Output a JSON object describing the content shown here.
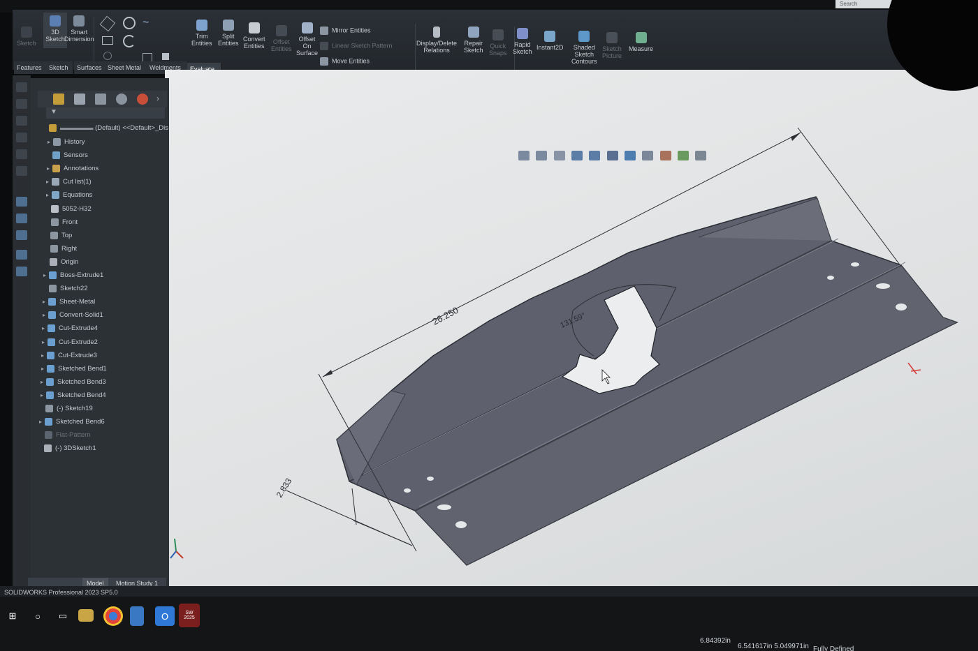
{
  "window": {
    "search_placeholder": "Search"
  },
  "ribbon": {
    "buttons": [
      {
        "label": "Sketch",
        "dim": true
      },
      {
        "label": "3D\nSketch"
      },
      {
        "label": "Smart\nDimension"
      },
      {
        "label": "Trim\nEntities"
      },
      {
        "label": "Split\nEntities"
      },
      {
        "label": "Convert\nEntities"
      },
      {
        "label": "Offset\nEntities",
        "dim": true
      },
      {
        "label": "Offset\nOn\nSurface"
      },
      {
        "label": "Display/Delete\nRelations"
      },
      {
        "label": "Repair\nSketch"
      },
      {
        "label": "Quick\nSnaps",
        "dim": true
      },
      {
        "label": "Rapid\nSketch"
      },
      {
        "label": "Instant2D"
      },
      {
        "label": "Shaded\nSketch\nContours"
      },
      {
        "label": "Sketch\nPicture",
        "dim": true
      },
      {
        "label": "Measure"
      }
    ],
    "mirror_entities": "Mirror Entities",
    "linear_sketch_pattern": "Linear Sketch Pattern",
    "move_entities": "Move Entities"
  },
  "tabs": [
    "Features",
    "Sketch",
    "Surfaces",
    "Sheet Metal",
    "Weldments",
    "Evaluate"
  ],
  "active_tab": "Evaluate",
  "feature_tree": {
    "root": "(Default) <<Default>_Dis",
    "items": [
      {
        "label": "History",
        "expand": true
      },
      {
        "label": "Sensors",
        "expand": false
      },
      {
        "label": "Annotations",
        "expand": true
      },
      {
        "label": "Cut list(1)",
        "expand": true
      },
      {
        "label": "Equations",
        "expand": true
      },
      {
        "label": "5052-H32",
        "expand": false
      },
      {
        "label": "Front",
        "expand": false
      },
      {
        "label": "Top",
        "expand": false
      },
      {
        "label": "Right",
        "expand": false
      },
      {
        "label": "Origin",
        "expand": false
      },
      {
        "label": "Boss-Extrude1",
        "expand": true
      },
      {
        "label": "Sketch22",
        "expand": false
      },
      {
        "label": "Sheet-Metal",
        "expand": true
      },
      {
        "label": "Convert-Solid1",
        "expand": true
      },
      {
        "label": "Cut-Extrude4",
        "expand": true
      },
      {
        "label": "Cut-Extrude2",
        "expand": true
      },
      {
        "label": "Cut-Extrude3",
        "expand": true
      },
      {
        "label": "Sketched Bend1",
        "expand": true
      },
      {
        "label": "Sketched Bend3",
        "expand": true
      },
      {
        "label": "Sketched Bend4",
        "expand": true
      },
      {
        "label": "(-) Sketch19",
        "expand": false
      },
      {
        "label": "Sketched Bend6",
        "expand": true
      },
      {
        "label": "Flat-Pattern",
        "expand": false,
        "dim": true
      },
      {
        "label": "(-) 3DSketch1",
        "expand": false
      }
    ]
  },
  "bottom_tabs": [
    "Model",
    "Motion Study 1"
  ],
  "status": {
    "product": "SOLIDWORKS Professional 2023 SP5.0",
    "coord_x": "6.84392in",
    "coord_yz": "6.541617in 5.049971in",
    "state": "Fully Defined"
  },
  "drawing": {
    "dim_length": "26.250",
    "dim_width": "2.833",
    "dim_angle": "131.59°"
  },
  "taskbar": {
    "sw_badge": "2025"
  },
  "colors": {
    "part_fill": "#5d5f6d",
    "part_edge": "#2e2f38",
    "viewport_bg": "#e3e5e6"
  }
}
